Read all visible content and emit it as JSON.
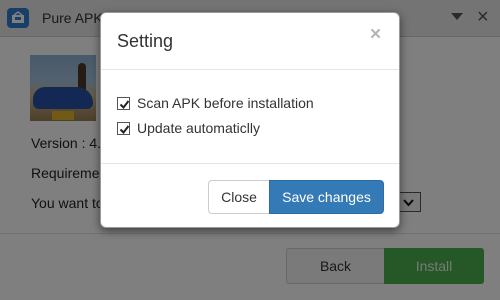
{
  "window": {
    "title": "Pure APK",
    "logo_icon": "pure-apk-logo-icon",
    "dropdown_icon": "triangle-down-icon",
    "close_glyph": "×"
  },
  "app_info": {
    "version_text": "Version : 4.",
    "requirement_text": "Requiremen",
    "want_text": "You want to"
  },
  "footer": {
    "back_label": "Back",
    "install_label": "Install"
  },
  "modal": {
    "title": "Setting",
    "close_glyph": "×",
    "options": [
      {
        "label": "Scan APK before installation",
        "checked": true
      },
      {
        "label": "Update automaticlly",
        "checked": true
      }
    ],
    "close_label": "Close",
    "save_label": "Save changes"
  },
  "colors": {
    "primary": "#337ab7",
    "install_green": "#4cae4c",
    "overlay": "rgba(0,0,0,0.5)"
  }
}
